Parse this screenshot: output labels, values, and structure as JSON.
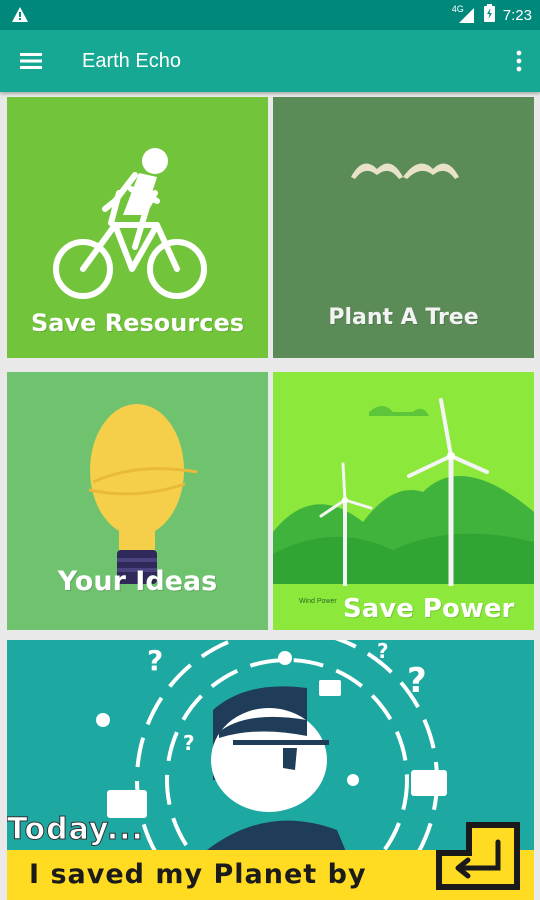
{
  "status_bar": {
    "time": "7:23",
    "network": "4G",
    "icons": [
      "warning-icon",
      "signal-icon",
      "battery-icon"
    ]
  },
  "app_bar": {
    "title": "Earth Echo",
    "icons": [
      "menu-icon",
      "overflow-menu-icon"
    ]
  },
  "tiles": [
    {
      "label": "Save Resources",
      "icon": "cyclist-icon",
      "color": "#72c53b"
    },
    {
      "label": "Plant A Tree",
      "icon": "birds-icon",
      "color": "#5b8c57"
    },
    {
      "label": "Your Ideas",
      "icon": "lightbulb-icon",
      "color": "#6fc36f"
    },
    {
      "label": "Save Power",
      "icon": "wind-turbine-icon",
      "caption": "Wind Power",
      "color": "#8ce93b"
    }
  ],
  "banner": {
    "today": "Today...",
    "strip_text": "I saved my Planet by",
    "icon": "enter-key-icon",
    "color": "#1ea8a2",
    "strip_color": "#ffdc21"
  },
  "colors": {
    "status_bar": "#00897b",
    "app_bar": "#17a893"
  }
}
